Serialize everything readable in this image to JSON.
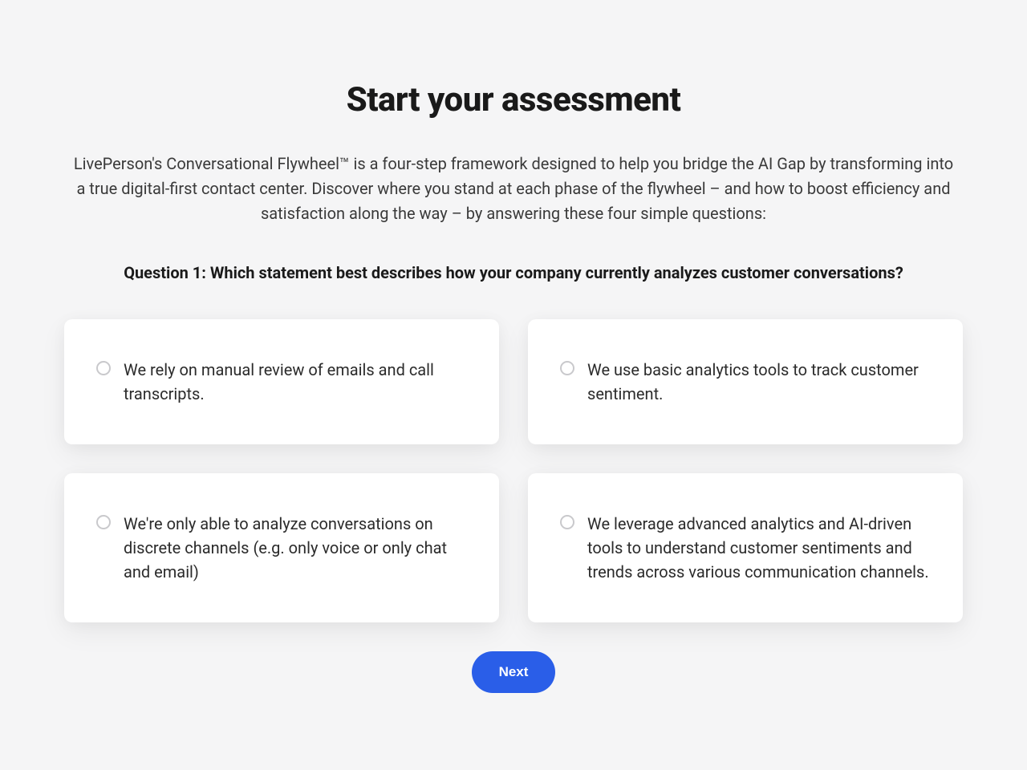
{
  "title": "Start your assessment",
  "description": "LivePerson's Conversational Flywheel™ is a four-step framework designed to help you bridge the AI Gap by transforming into a true digital-first contact center. Discover where you stand at each phase of the flywheel – and how to boost efficiency and satisfaction along the way – by answering these four simple questions:",
  "question": "Question 1: Which statement best describes how your company currently analyzes customer conversations?",
  "options": [
    "We rely on manual review of emails and call transcripts.",
    "We use basic analytics tools to track customer sentiment.",
    "We're only able to analyze conversations on discrete channels (e.g. only voice or only chat and email)",
    "We leverage advanced analytics and AI-driven tools to understand customer sentiments and trends across various communication channels."
  ],
  "next_label": "Next"
}
